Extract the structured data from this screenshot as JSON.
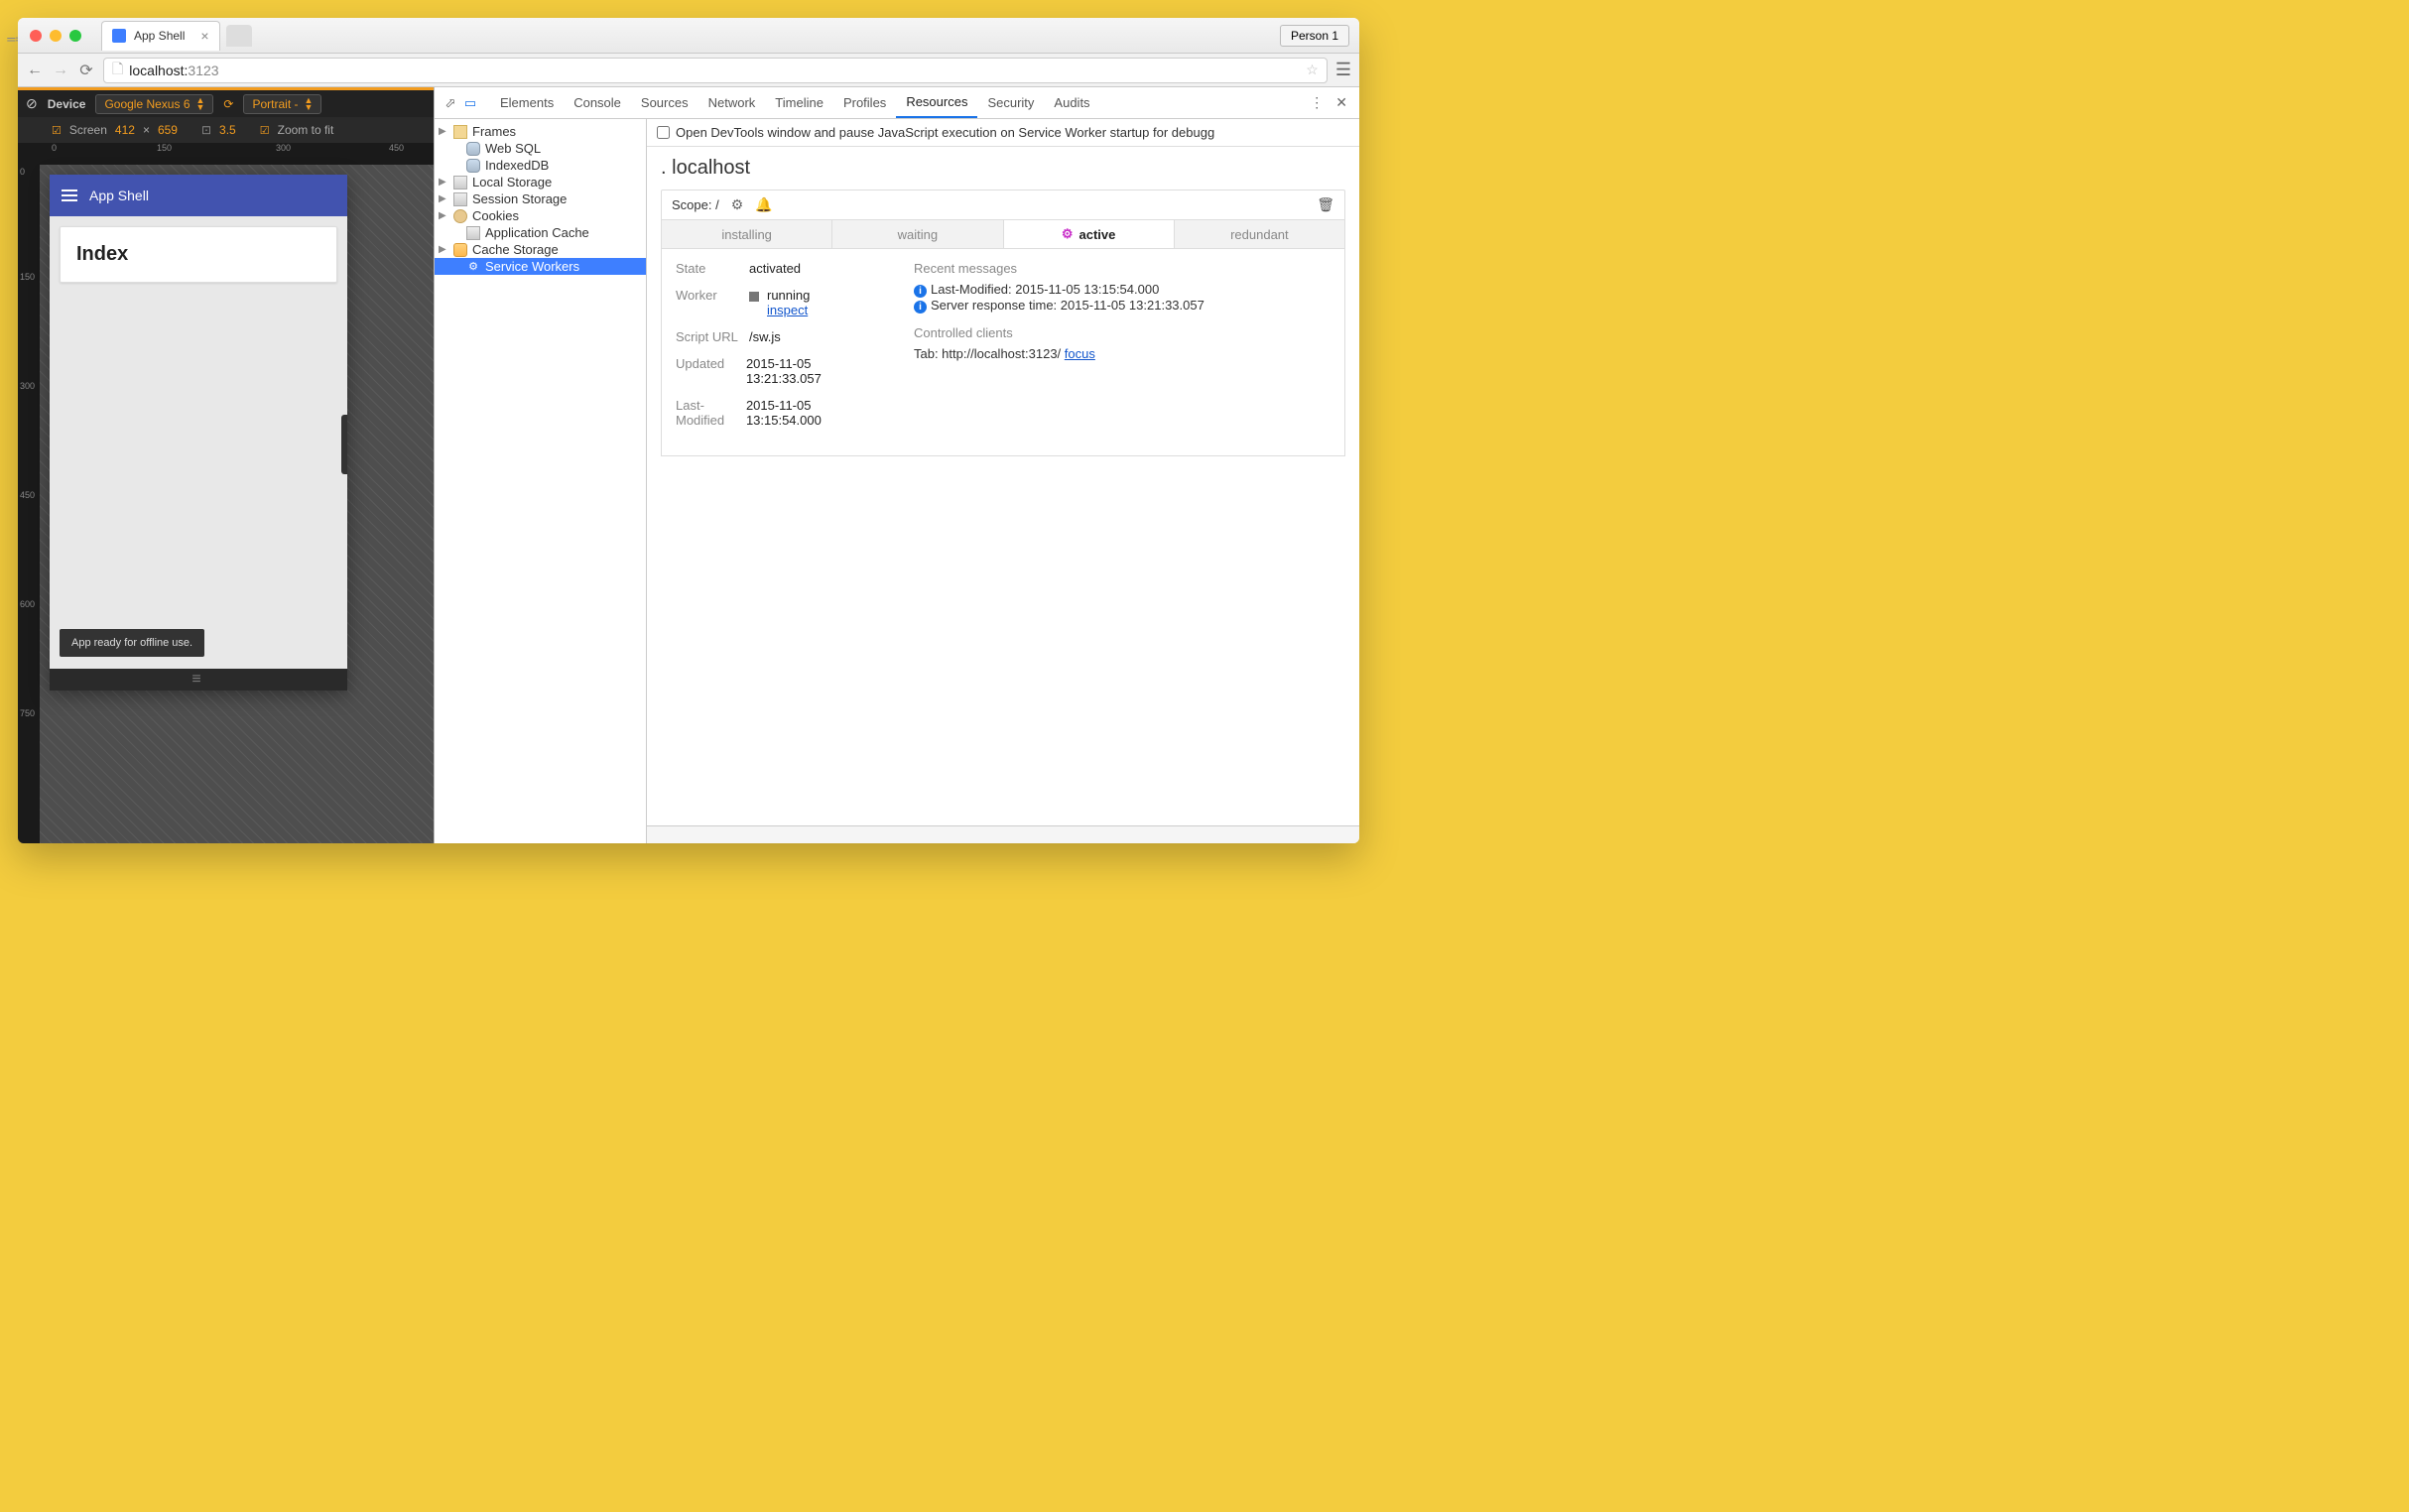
{
  "browser": {
    "tab_title": "App Shell",
    "url_display_host": "localhost:",
    "url_display_port": "3123",
    "profile": "Person 1"
  },
  "device_toolbar": {
    "device_label": "Device",
    "device_name": "Google Nexus 6",
    "orientation": "Portrait -",
    "screen_label": "Screen",
    "width": "412",
    "height": "659",
    "dimension_sep": "×",
    "dpr": "3.5",
    "zoom_label": "Zoom to fit",
    "ruler_h": [
      "0",
      "150",
      "300",
      "450"
    ],
    "ruler_v": [
      "0",
      "150",
      "300",
      "450",
      "600",
      "750"
    ]
  },
  "app": {
    "title": "App Shell",
    "card_heading": "Index",
    "toast": "App ready for offline use."
  },
  "devtools": {
    "tabs": [
      "Elements",
      "Console",
      "Sources",
      "Network",
      "Timeline",
      "Profiles",
      "Resources",
      "Security",
      "Audits"
    ],
    "active_tab": "Resources",
    "pause_label": "Open DevTools window and pause JavaScript execution on Service Worker startup for debugg",
    "resources_tree": [
      {
        "label": "Frames",
        "icon": "folder",
        "arrow": true
      },
      {
        "label": "Web SQL",
        "icon": "db",
        "arrow": false,
        "indent": true
      },
      {
        "label": "IndexedDB",
        "icon": "db",
        "arrow": false,
        "indent": true
      },
      {
        "label": "Local Storage",
        "icon": "grid",
        "arrow": true
      },
      {
        "label": "Session Storage",
        "icon": "grid",
        "arrow": true
      },
      {
        "label": "Cookies",
        "icon": "cookie",
        "arrow": true
      },
      {
        "label": "Application Cache",
        "icon": "grid",
        "arrow": false,
        "indent": true
      },
      {
        "label": "Cache Storage",
        "icon": "cache",
        "arrow": true
      },
      {
        "label": "Service Workers",
        "icon": "gear",
        "arrow": false,
        "indent": true,
        "selected": true
      }
    ],
    "sw": {
      "origin": "localhost",
      "scope_label": "Scope: /",
      "tabs": [
        "installing",
        "waiting",
        "active",
        "redundant"
      ],
      "active_tab": "active",
      "state_label": "State",
      "state_value": "activated",
      "worker_label": "Worker",
      "worker_status": "running",
      "worker_inspect": "inspect",
      "script_label": "Script URL",
      "script_value": "/sw.js",
      "updated_label": "Updated",
      "updated_value": "2015-11-05 13:21:33.057",
      "lastmod_label": "Last-Modified",
      "lastmod_value": "2015-11-05 13:15:54.000",
      "recent_label": "Recent messages",
      "msg1": "Last-Modified: 2015-11-05 13:15:54.000",
      "msg2": "Server response time: 2015-11-05 13:21:33.057",
      "clients_label": "Controlled clients",
      "client_prefix": "Tab: http://localhost:3123/ ",
      "client_focus": "focus"
    }
  }
}
